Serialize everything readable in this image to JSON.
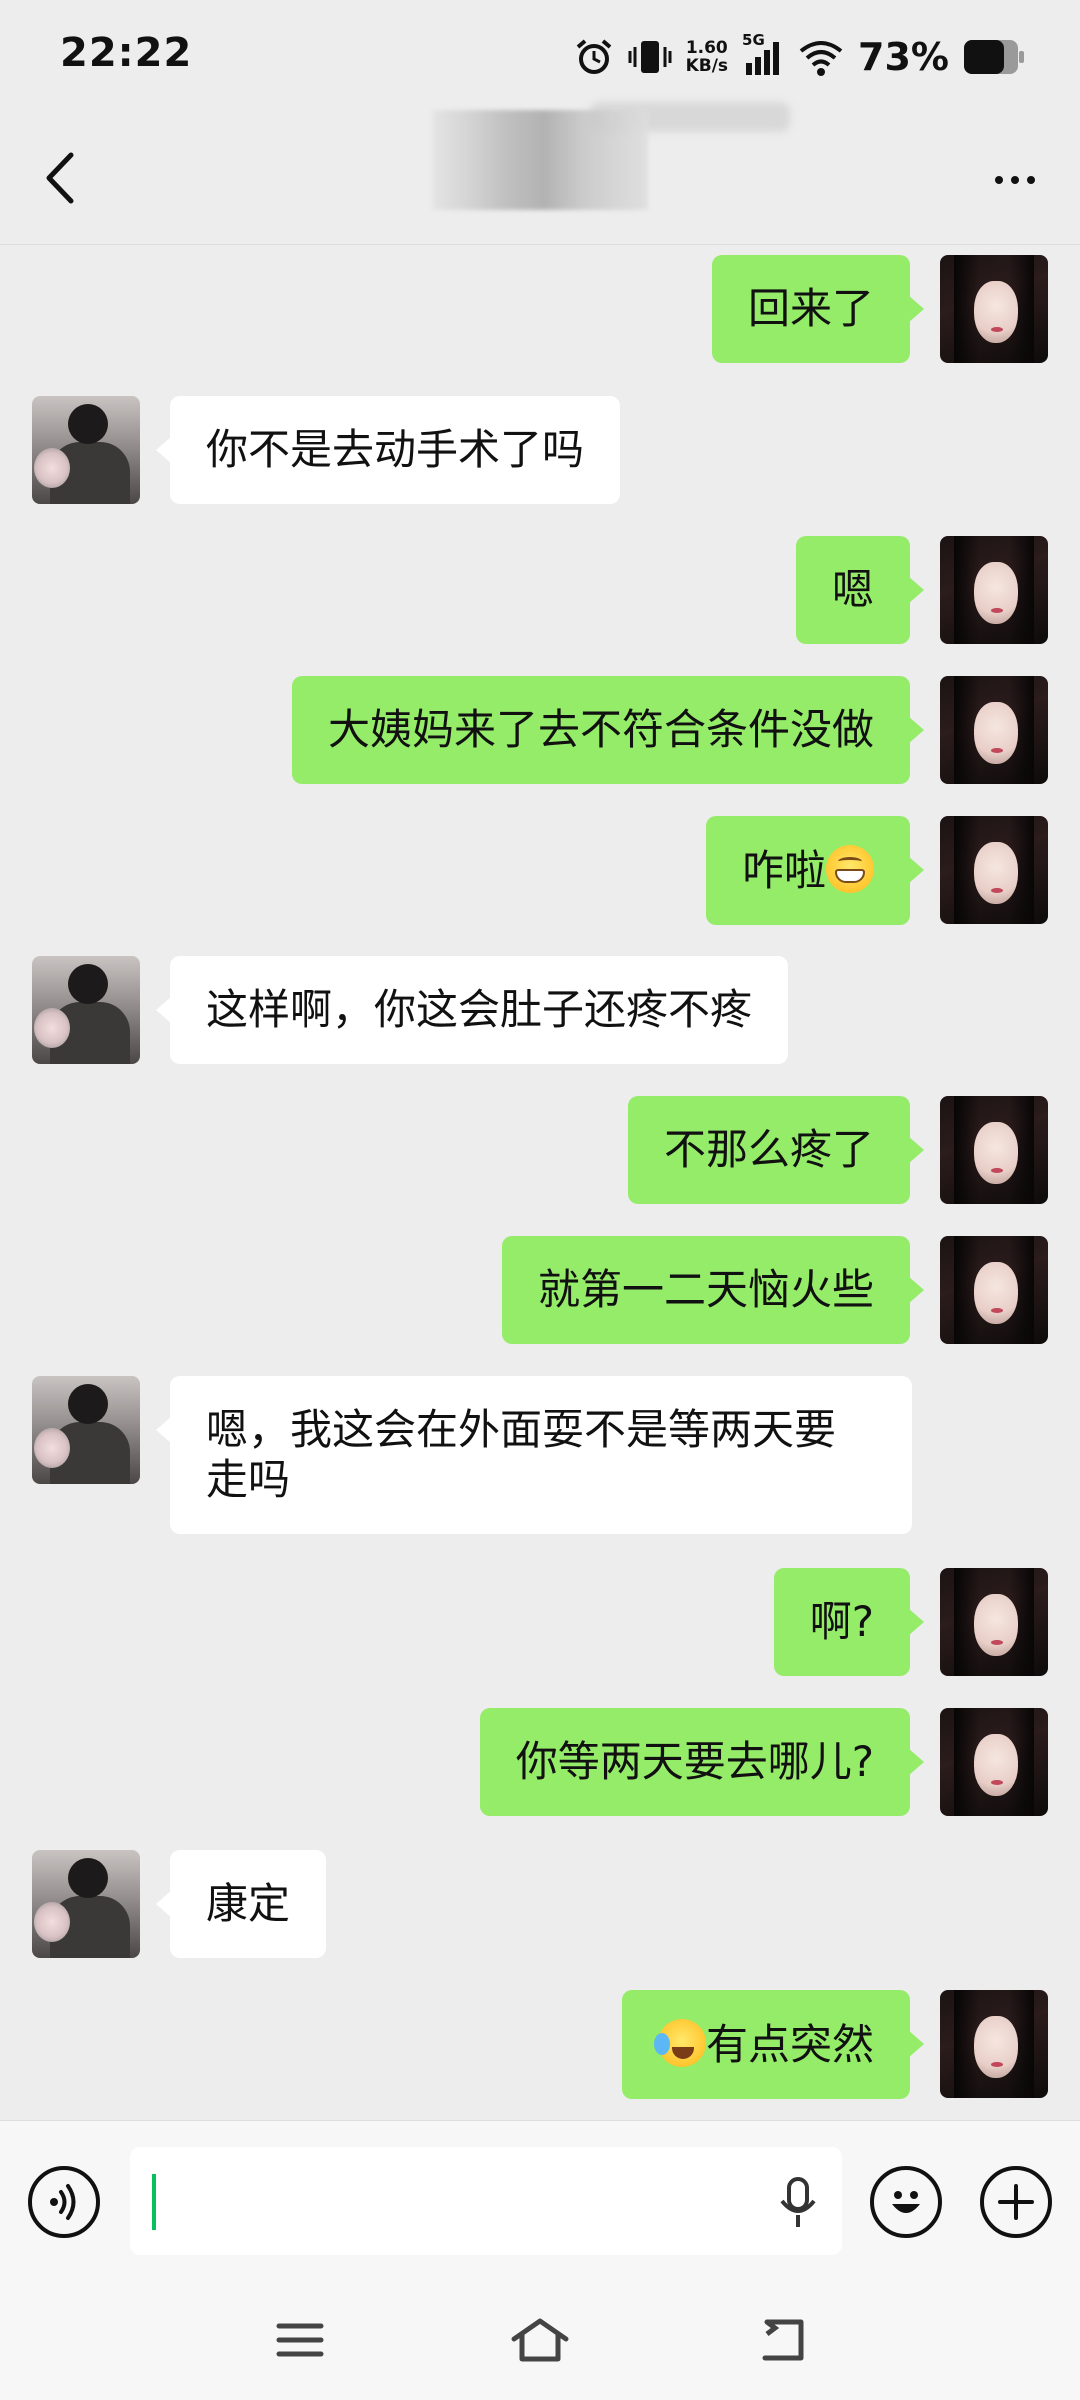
{
  "status_bar": {
    "time": "22:22",
    "net_speed_value": "1.60",
    "net_speed_unit": "KB/s",
    "signal_label": "5G",
    "battery_percent": "73%",
    "icons": [
      "alarm-icon",
      "vibrate-icon",
      "signal-icon",
      "wifi-icon",
      "battery-icon"
    ]
  },
  "nav": {
    "back_icon": "chevron-left-icon",
    "more_icon": "more-dots-icon"
  },
  "messages": [
    {
      "sender": "me",
      "text": "回来了"
    },
    {
      "sender": "other",
      "text": "你不是去动手术了吗"
    },
    {
      "sender": "me",
      "text": "嗯"
    },
    {
      "sender": "me",
      "text": "大姨妈来了去不符合条件没做"
    },
    {
      "sender": "me",
      "text": "咋啦",
      "emoji_after": "grinning-emoji"
    },
    {
      "sender": "other",
      "text": "这样啊，你这会肚子还疼不疼"
    },
    {
      "sender": "me",
      "text": "不那么疼了"
    },
    {
      "sender": "me",
      "text": "就第一二天恼火些"
    },
    {
      "sender": "other",
      "text": "嗯，我这会在外面耍不是等两天要走吗"
    },
    {
      "sender": "me",
      "text": "啊?"
    },
    {
      "sender": "me",
      "text": "你等两天要去哪儿?"
    },
    {
      "sender": "other",
      "text": "康定"
    },
    {
      "sender": "me",
      "text": "有点突然",
      "emoji_before": "laughing-crying-emoji"
    }
  ],
  "input_bar": {
    "value": "",
    "icons": [
      "voice-icon",
      "mic-icon",
      "emoji-icon",
      "plus-icon"
    ]
  },
  "system_nav": {
    "icons": [
      "menu-icon",
      "home-icon",
      "back-icon"
    ]
  },
  "colors": {
    "background": "#ededed",
    "bubble_me": "#95ec69",
    "bubble_other": "#ffffff",
    "caret": "#07c160"
  }
}
